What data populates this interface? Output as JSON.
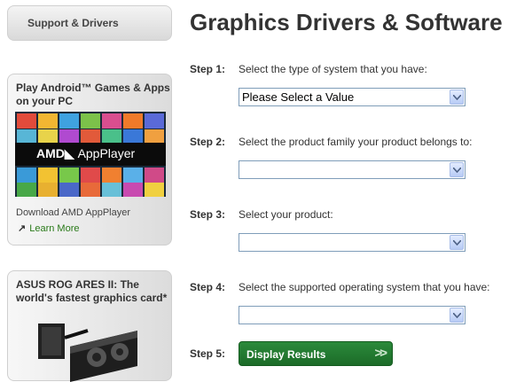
{
  "sidebar": {
    "tab_label": "Support & Drivers",
    "promo1": {
      "title": "Play Android™ Games & Apps on your PC",
      "banner_brand": "AMD",
      "banner_product": "AppPlayer",
      "text": "Download AMD AppPlayer",
      "link": "Learn More"
    },
    "promo2": {
      "title": "ASUS ROG ARES II: The world's fastest graphics card*"
    }
  },
  "main": {
    "title": "Graphics Drivers & Software",
    "steps": [
      {
        "label": "Step 1:",
        "text": "Select the type of system that you have:",
        "value": "Please Select a Value"
      },
      {
        "label": "Step 2:",
        "text": "Select the product family your product belongs to:",
        "value": ""
      },
      {
        "label": "Step 3:",
        "text": "Select your product:",
        "value": ""
      },
      {
        "label": "Step 4:",
        "text": "Select the supported operating system that you have:",
        "value": ""
      },
      {
        "label": "Step 5:"
      }
    ],
    "button_label": "Display Results",
    "button_chevrons": ">>"
  },
  "colors": {
    "accent_green": "#1c6b28",
    "link_green": "#2a7a1a",
    "select_border": "#7f9db9"
  }
}
